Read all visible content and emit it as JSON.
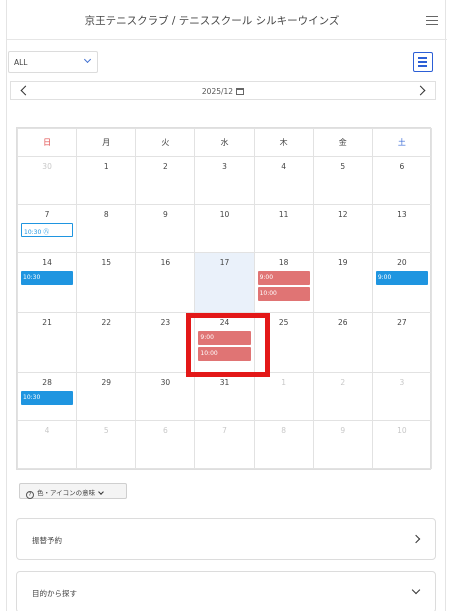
{
  "header": {
    "title": "京王テニスクラブ / テニススクール シルキーウインズ"
  },
  "filter": {
    "selected": "ALL"
  },
  "month_nav": {
    "label": "2025/12"
  },
  "calendar": {
    "weekdays": [
      "日",
      "月",
      "火",
      "水",
      "木",
      "金",
      "土"
    ],
    "weeks": [
      [
        {
          "d": "30",
          "m": true
        },
        {
          "d": "1"
        },
        {
          "d": "2"
        },
        {
          "d": "3"
        },
        {
          "d": "4"
        },
        {
          "d": "5"
        },
        {
          "d": "6"
        }
      ],
      [
        {
          "d": "7",
          "ev": [
            {
              "t": "10:30 ㊇",
              "c": "outline"
            }
          ]
        },
        {
          "d": "8"
        },
        {
          "d": "9"
        },
        {
          "d": "10"
        },
        {
          "d": "11"
        },
        {
          "d": "12"
        },
        {
          "d": "13"
        }
      ],
      [
        {
          "d": "14",
          "ev": [
            {
              "t": "10:30",
              "c": "blue"
            }
          ]
        },
        {
          "d": "15"
        },
        {
          "d": "16"
        },
        {
          "d": "17",
          "today": true
        },
        {
          "d": "18",
          "ev": [
            {
              "t": "9:00",
              "c": "red"
            },
            {
              "t": "10:00",
              "c": "red"
            }
          ]
        },
        {
          "d": "19"
        },
        {
          "d": "20",
          "ev": [
            {
              "t": "9:00",
              "c": "blue"
            }
          ]
        }
      ],
      [
        {
          "d": "21"
        },
        {
          "d": "22"
        },
        {
          "d": "23"
        },
        {
          "d": "24",
          "ev": [
            {
              "t": "9:00",
              "c": "red"
            },
            {
              "t": "10:00",
              "c": "red"
            }
          ]
        },
        {
          "d": "25"
        },
        {
          "d": "26"
        },
        {
          "d": "27"
        }
      ],
      [
        {
          "d": "28",
          "ev": [
            {
              "t": "10:30",
              "c": "blue"
            }
          ]
        },
        {
          "d": "29"
        },
        {
          "d": "30"
        },
        {
          "d": "31"
        },
        {
          "d": "1",
          "m": true
        },
        {
          "d": "2",
          "m": true
        },
        {
          "d": "3",
          "m": true
        }
      ],
      [
        {
          "d": "4",
          "m": true
        },
        {
          "d": "5",
          "m": true
        },
        {
          "d": "6",
          "m": true
        },
        {
          "d": "7",
          "m": true
        },
        {
          "d": "8",
          "m": true
        },
        {
          "d": "9",
          "m": true
        },
        {
          "d": "10",
          "m": true
        }
      ]
    ]
  },
  "legend": {
    "label": "色・アイコンの意味"
  },
  "panels": {
    "transfer": {
      "label": "振替予約"
    },
    "purpose": {
      "label": "目的から探す"
    }
  },
  "colors": {
    "event_blue": "#1f95e0",
    "event_red": "#e07474",
    "highlight": "#e31818",
    "today": "#eaf1fa"
  }
}
